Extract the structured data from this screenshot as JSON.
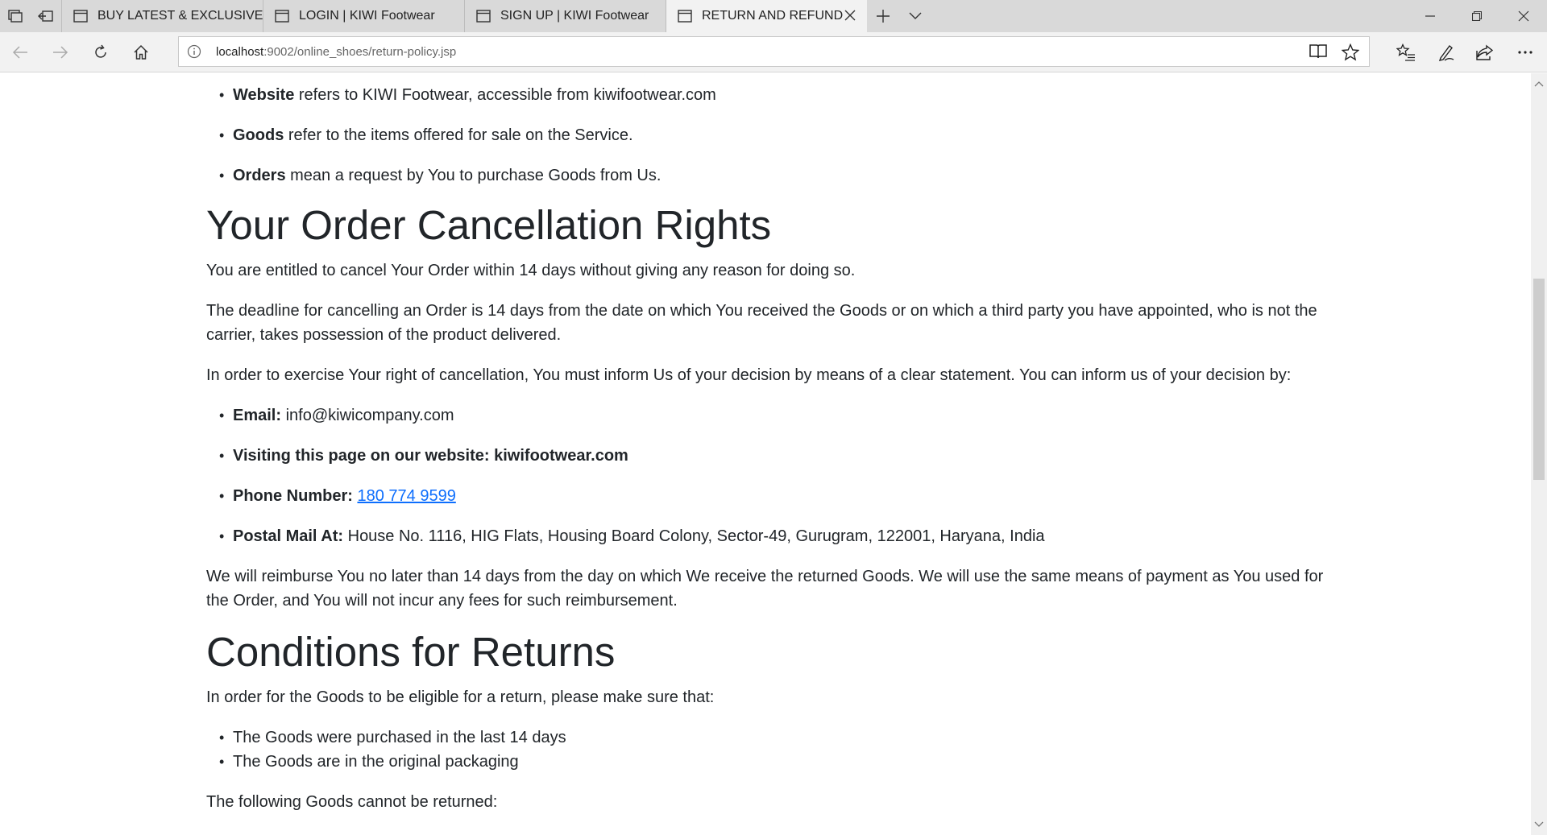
{
  "browser": {
    "tabs": [
      {
        "title": "BUY LATEST & EXCLUSIVE F",
        "active": false
      },
      {
        "title": "LOGIN | KIWI Footwear",
        "active": false
      },
      {
        "title": "SIGN UP | KIWI Footwear",
        "active": false
      },
      {
        "title": "RETURN AND REFUND",
        "active": true
      }
    ],
    "url_host": "localhost",
    "url_rest": ":9002/online_shoes/return-policy.jsp"
  },
  "page": {
    "definitions": [
      {
        "term": "Website",
        "text": " refers to KIWI Footwear, accessible from ",
        "link": "kiwifootwear.com"
      },
      {
        "term": "Goods",
        "text": " refer to the items offered for sale on the Service."
      },
      {
        "term": "Orders",
        "text": " mean a request by You to purchase Goods from Us."
      }
    ],
    "cancellation": {
      "heading": "Your Order Cancellation Rights",
      "p1": "You are entitled to cancel Your Order within 14 days without giving any reason for doing so.",
      "p2": "The deadline for cancelling an Order is 14 days from the date on which You received the Goods or on which a third party you have appointed, who is not the carrier, takes possession of the product delivered.",
      "p3": "In order to exercise Your right of cancellation, You must inform Us of your decision by means of a clear statement. You can inform us of your decision by:",
      "email_label": "Email:",
      "email_value": " info@kiwicompany.com",
      "visit_label": "Visiting this page on our website: kiwifootwear.com",
      "phone_label": "Phone Number:",
      "phone_value": "180 774 9599",
      "postal_label": "Postal Mail At:",
      "postal_value": " House No. 1116, HIG Flats, Housing Board Colony, Sector-49, Gurugram, 122001, Haryana, India",
      "p4": "We will reimburse You no later than 14 days from the day on which We receive the returned Goods. We will use the same means of payment as You used for the Order, and You will not incur any fees for such reimbursement."
    },
    "returns": {
      "heading": "Conditions for Returns",
      "intro": "In order for the Goods to be eligible for a return, please make sure that:",
      "items": [
        "The Goods were purchased in the last 14 days",
        "The Goods are in the original packaging"
      ],
      "cannot": "The following Goods cannot be returned:"
    }
  }
}
